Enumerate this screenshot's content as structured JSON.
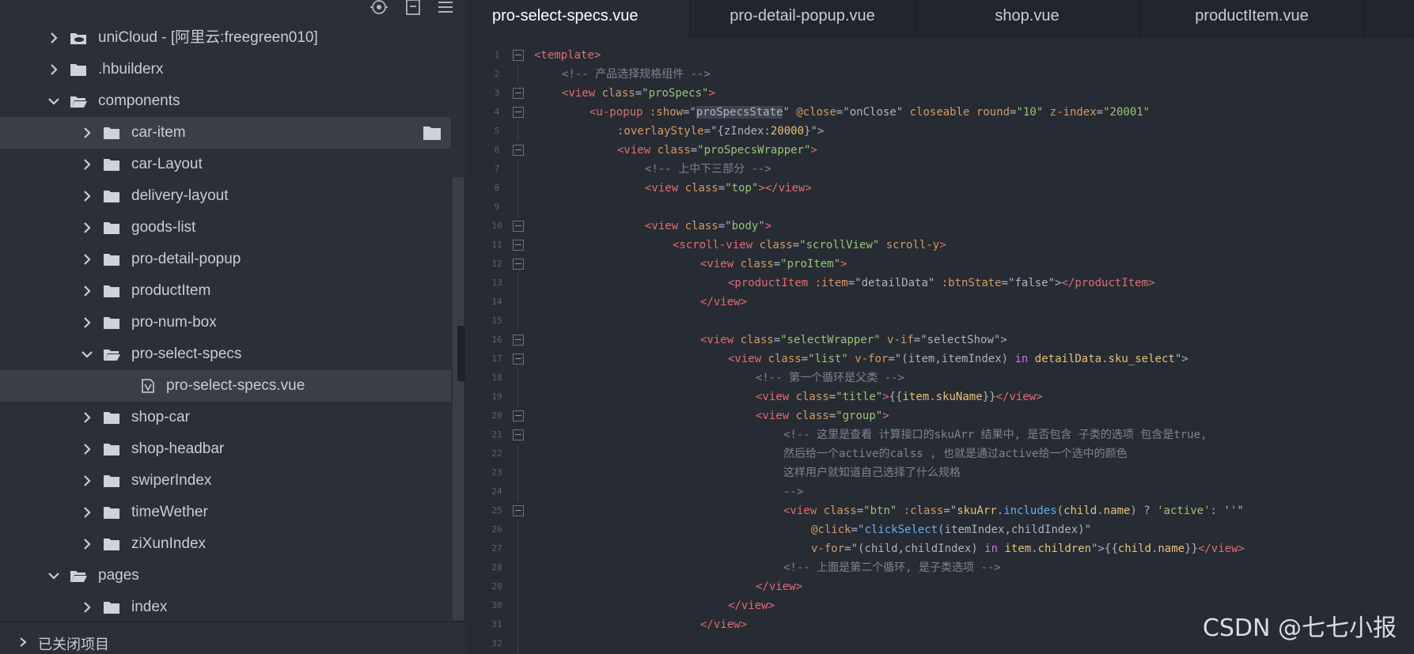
{
  "sidebar": {
    "toolbar_icons": [
      "target-icon",
      "collapse-all-icon",
      "menu-icon"
    ],
    "tree": [
      {
        "label": "uniCloud",
        "sub": " - [阿里云:freegreen010]",
        "level": 1,
        "expanded": false,
        "icon": "cloud-folder-icon"
      },
      {
        "label": ".hbuilderx",
        "level": 1,
        "expanded": false,
        "icon": "folder-icon"
      },
      {
        "label": "components",
        "level": 1,
        "expanded": true,
        "icon": "folder-open-icon"
      },
      {
        "label": "car-item",
        "level": 2,
        "expanded": false,
        "icon": "folder-icon",
        "highlight": true
      },
      {
        "label": "car-Layout",
        "level": 2,
        "expanded": false,
        "icon": "folder-icon"
      },
      {
        "label": "delivery-layout",
        "level": 2,
        "expanded": false,
        "icon": "folder-icon"
      },
      {
        "label": "goods-list",
        "level": 2,
        "expanded": false,
        "icon": "folder-icon"
      },
      {
        "label": "pro-detail-popup",
        "level": 2,
        "expanded": false,
        "icon": "folder-icon"
      },
      {
        "label": "productItem",
        "level": 2,
        "expanded": false,
        "icon": "folder-icon"
      },
      {
        "label": "pro-num-box",
        "level": 2,
        "expanded": false,
        "icon": "folder-icon"
      },
      {
        "label": "pro-select-specs",
        "level": 2,
        "expanded": true,
        "icon": "folder-open-icon"
      },
      {
        "label": "pro-select-specs.vue",
        "level": 3,
        "file": true,
        "icon": "vue-file-icon",
        "highlight": true
      },
      {
        "label": "shop-car",
        "level": 2,
        "expanded": false,
        "icon": "folder-icon"
      },
      {
        "label": "shop-headbar",
        "level": 2,
        "expanded": false,
        "icon": "folder-icon"
      },
      {
        "label": "swiperIndex",
        "level": 2,
        "expanded": false,
        "icon": "folder-icon"
      },
      {
        "label": "timeWether",
        "level": 2,
        "expanded": false,
        "icon": "folder-icon"
      },
      {
        "label": "ziXunIndex",
        "level": 2,
        "expanded": false,
        "icon": "folder-icon"
      },
      {
        "label": "pages",
        "level": 1,
        "expanded": true,
        "icon": "folder-open-icon"
      },
      {
        "label": "index",
        "level": 2,
        "expanded": false,
        "icon": "folder-icon"
      }
    ],
    "closed_projects_label": "已关闭项目"
  },
  "tabs": [
    {
      "label": "pro-select-specs.vue",
      "active": true
    },
    {
      "label": "pro-detail-popup.vue",
      "active": false
    },
    {
      "label": "shop.vue",
      "active": false
    },
    {
      "label": "productItem.vue",
      "active": false
    }
  ],
  "code_lines": [
    {
      "n": "1",
      "fold": true,
      "indent": 0,
      "tokens": [
        [
          "tag",
          "<template>"
        ]
      ]
    },
    {
      "n": "2",
      "fold": false,
      "indent": 1,
      "tokens": [
        [
          "cmt",
          "<!-- 产品选择规格组件 -->"
        ]
      ]
    },
    {
      "n": "3",
      "fold": true,
      "indent": 1,
      "tokens": [
        [
          "tag",
          "<view "
        ],
        [
          "attr",
          "class"
        ],
        [
          "punc",
          "="
        ],
        [
          "str",
          "\"proSpecs\""
        ],
        [
          "tag",
          ">"
        ]
      ]
    },
    {
      "n": "4",
      "fold": true,
      "indent": 2,
      "tokens": [
        [
          "tag",
          "<u-popup "
        ],
        [
          "attr",
          ":show"
        ],
        [
          "punc",
          "=\""
        ],
        [
          "hl",
          "proSpecsState"
        ],
        [
          "punc",
          "\" "
        ],
        [
          "attr",
          "@close"
        ],
        [
          "punc",
          "=\"onClose\" "
        ],
        [
          "attr",
          "closeable "
        ],
        [
          "attr",
          "round"
        ],
        [
          "punc",
          "="
        ],
        [
          "str",
          "\"10\" "
        ],
        [
          "attr",
          "z-index"
        ],
        [
          "punc",
          "="
        ],
        [
          "str",
          "\"20001\""
        ]
      ]
    },
    {
      "n": "5",
      "fold": false,
      "indent": 3,
      "tokens": [
        [
          "attr",
          ":overlayStyle"
        ],
        [
          "punc",
          "=\"{zIndex:"
        ],
        [
          "var",
          "20000"
        ],
        [
          "punc",
          "}\">"
        ]
      ]
    },
    {
      "n": "6",
      "fold": true,
      "indent": 3,
      "tokens": [
        [
          "tag",
          "<view "
        ],
        [
          "attr",
          "class"
        ],
        [
          "punc",
          "="
        ],
        [
          "str",
          "\"proSpecsWrapper\""
        ],
        [
          "tag",
          ">"
        ]
      ]
    },
    {
      "n": "7",
      "fold": false,
      "indent": 4,
      "tokens": [
        [
          "cmt",
          "<!-- 上中下三部分 -->"
        ]
      ]
    },
    {
      "n": "8",
      "fold": false,
      "indent": 4,
      "tokens": [
        [
          "tag",
          "<view "
        ],
        [
          "attr",
          "class"
        ],
        [
          "punc",
          "="
        ],
        [
          "str",
          "\"top\""
        ],
        [
          "tag",
          "></view>"
        ]
      ]
    },
    {
      "n": "9",
      "fold": false,
      "indent": 0,
      "tokens": []
    },
    {
      "n": "10",
      "fold": true,
      "indent": 4,
      "tokens": [
        [
          "tag",
          "<view "
        ],
        [
          "attr",
          "class"
        ],
        [
          "punc",
          "="
        ],
        [
          "str",
          "\"body\""
        ],
        [
          "tag",
          ">"
        ]
      ]
    },
    {
      "n": "11",
      "fold": true,
      "indent": 5,
      "tokens": [
        [
          "tag",
          "<scroll-view "
        ],
        [
          "attr",
          "class"
        ],
        [
          "punc",
          "="
        ],
        [
          "str",
          "\"scrollView\" "
        ],
        [
          "attr",
          "scroll-y"
        ],
        [
          "tag",
          ">"
        ]
      ]
    },
    {
      "n": "12",
      "fold": true,
      "indent": 6,
      "tokens": [
        [
          "tag",
          "<view "
        ],
        [
          "attr",
          "class"
        ],
        [
          "punc",
          "="
        ],
        [
          "str",
          "\"proItem\""
        ],
        [
          "tag",
          ">"
        ]
      ]
    },
    {
      "n": "13",
      "fold": false,
      "indent": 7,
      "tokens": [
        [
          "tag",
          "<productItem "
        ],
        [
          "attr",
          ":item"
        ],
        [
          "punc",
          "=\"detailData\" "
        ],
        [
          "attr",
          ":btnState"
        ],
        [
          "punc",
          "=\"false\">"
        ],
        [
          "tag",
          "</productItem>"
        ]
      ]
    },
    {
      "n": "14",
      "fold": false,
      "indent": 6,
      "tokens": [
        [
          "tag",
          "</view>"
        ]
      ]
    },
    {
      "n": "15",
      "fold": false,
      "indent": 0,
      "tokens": []
    },
    {
      "n": "16",
      "fold": true,
      "indent": 6,
      "tokens": [
        [
          "tag",
          "<view "
        ],
        [
          "attr",
          "class"
        ],
        [
          "punc",
          "="
        ],
        [
          "str",
          "\"selectWrapper\" "
        ],
        [
          "attr",
          "v-if"
        ],
        [
          "punc",
          "=\"selectShow\">"
        ]
      ]
    },
    {
      "n": "17",
      "fold": true,
      "indent": 7,
      "tokens": [
        [
          "tag",
          "<view "
        ],
        [
          "attr",
          "class"
        ],
        [
          "punc",
          "="
        ],
        [
          "str",
          "\"list\" "
        ],
        [
          "attr",
          "v-for"
        ],
        [
          "punc",
          "=\"(item,itemIndex) "
        ],
        [
          "kw",
          "in "
        ],
        [
          "var",
          "detailData"
        ],
        [
          "punc",
          "."
        ],
        [
          "var",
          "sku_select"
        ],
        [
          "punc",
          "\">"
        ]
      ]
    },
    {
      "n": "18",
      "fold": false,
      "indent": 8,
      "tokens": [
        [
          "cmt",
          "<!-- 第一个循环是父类 -->"
        ]
      ]
    },
    {
      "n": "19",
      "fold": false,
      "indent": 8,
      "tokens": [
        [
          "tag",
          "<view "
        ],
        [
          "attr",
          "class"
        ],
        [
          "punc",
          "="
        ],
        [
          "str",
          "\"title\""
        ],
        [
          "tag",
          ">"
        ],
        [
          "punc",
          "{{"
        ],
        [
          "var",
          "item"
        ],
        [
          "punc",
          "."
        ],
        [
          "var",
          "skuName"
        ],
        [
          "punc",
          "}}"
        ],
        [
          "tag",
          "</view>"
        ]
      ]
    },
    {
      "n": "20",
      "fold": true,
      "indent": 8,
      "tokens": [
        [
          "tag",
          "<view "
        ],
        [
          "attr",
          "class"
        ],
        [
          "punc",
          "="
        ],
        [
          "str",
          "\"group\""
        ],
        [
          "tag",
          ">"
        ]
      ]
    },
    {
      "n": "21",
      "fold": true,
      "indent": 9,
      "tokens": [
        [
          "cmt",
          "<!-- 这里是查看 计算接口的skuArr 结果中, 是否包含 子类的选项 包含是true,"
        ]
      ]
    },
    {
      "n": "22",
      "fold": false,
      "indent": 9,
      "tokens": [
        [
          "cmt",
          "然后给一个active的calss , 也就是通过active给一个选中的颜色"
        ]
      ]
    },
    {
      "n": "23",
      "fold": false,
      "indent": 9,
      "tokens": [
        [
          "cmt",
          "这样用户就知道自己选择了什么规格"
        ]
      ]
    },
    {
      "n": "24",
      "fold": false,
      "indent": 9,
      "tokens": [
        [
          "cmt",
          "-->"
        ]
      ]
    },
    {
      "n": "25",
      "fold": true,
      "indent": 9,
      "tokens": [
        [
          "tag",
          "<view "
        ],
        [
          "attr",
          "class"
        ],
        [
          "punc",
          "="
        ],
        [
          "str",
          "\"btn\" "
        ],
        [
          "attr",
          ":class"
        ],
        [
          "punc",
          "=\""
        ],
        [
          "var",
          "skuArr"
        ],
        [
          "punc",
          "."
        ],
        [
          "fn",
          "includes"
        ],
        [
          "punc",
          "("
        ],
        [
          "var",
          "child"
        ],
        [
          "punc",
          "."
        ],
        [
          "var",
          "name"
        ],
        [
          "punc",
          ") ? "
        ],
        [
          "str",
          "'active'"
        ],
        [
          "punc",
          ": "
        ],
        [
          "str",
          "''"
        ],
        [
          "punc",
          "\""
        ]
      ]
    },
    {
      "n": "26",
      "fold": false,
      "indent": 10,
      "tokens": [
        [
          "attr",
          "@click"
        ],
        [
          "punc",
          "=\""
        ],
        [
          "fn",
          "clickSelect"
        ],
        [
          "punc",
          "(itemIndex,childIndex)\""
        ]
      ]
    },
    {
      "n": "27",
      "fold": false,
      "indent": 10,
      "tokens": [
        [
          "attr",
          "v-for"
        ],
        [
          "punc",
          "=\"(child,childIndex) "
        ],
        [
          "kw",
          "in "
        ],
        [
          "var",
          "item"
        ],
        [
          "punc",
          "."
        ],
        [
          "var",
          "children"
        ],
        [
          "punc",
          "\">{{"
        ],
        [
          "var",
          "child"
        ],
        [
          "punc",
          "."
        ],
        [
          "var",
          "name"
        ],
        [
          "punc",
          "}}"
        ],
        [
          "tag",
          "</view>"
        ]
      ]
    },
    {
      "n": "28",
      "fold": false,
      "indent": 9,
      "tokens": [
        [
          "cmt",
          "<!-- 上面是第二个循环, 是子类选项 -->"
        ]
      ]
    },
    {
      "n": "29",
      "fold": false,
      "indent": 8,
      "tokens": [
        [
          "tag",
          "</view>"
        ]
      ]
    },
    {
      "n": "30",
      "fold": false,
      "indent": 7,
      "tokens": [
        [
          "tag",
          "</view>"
        ]
      ]
    },
    {
      "n": "31",
      "fold": false,
      "indent": 6,
      "tokens": [
        [
          "tag",
          "</view>"
        ]
      ]
    },
    {
      "n": "32",
      "fold": false,
      "indent": 0,
      "tokens": []
    }
  ],
  "watermark": "CSDN @七七小报"
}
